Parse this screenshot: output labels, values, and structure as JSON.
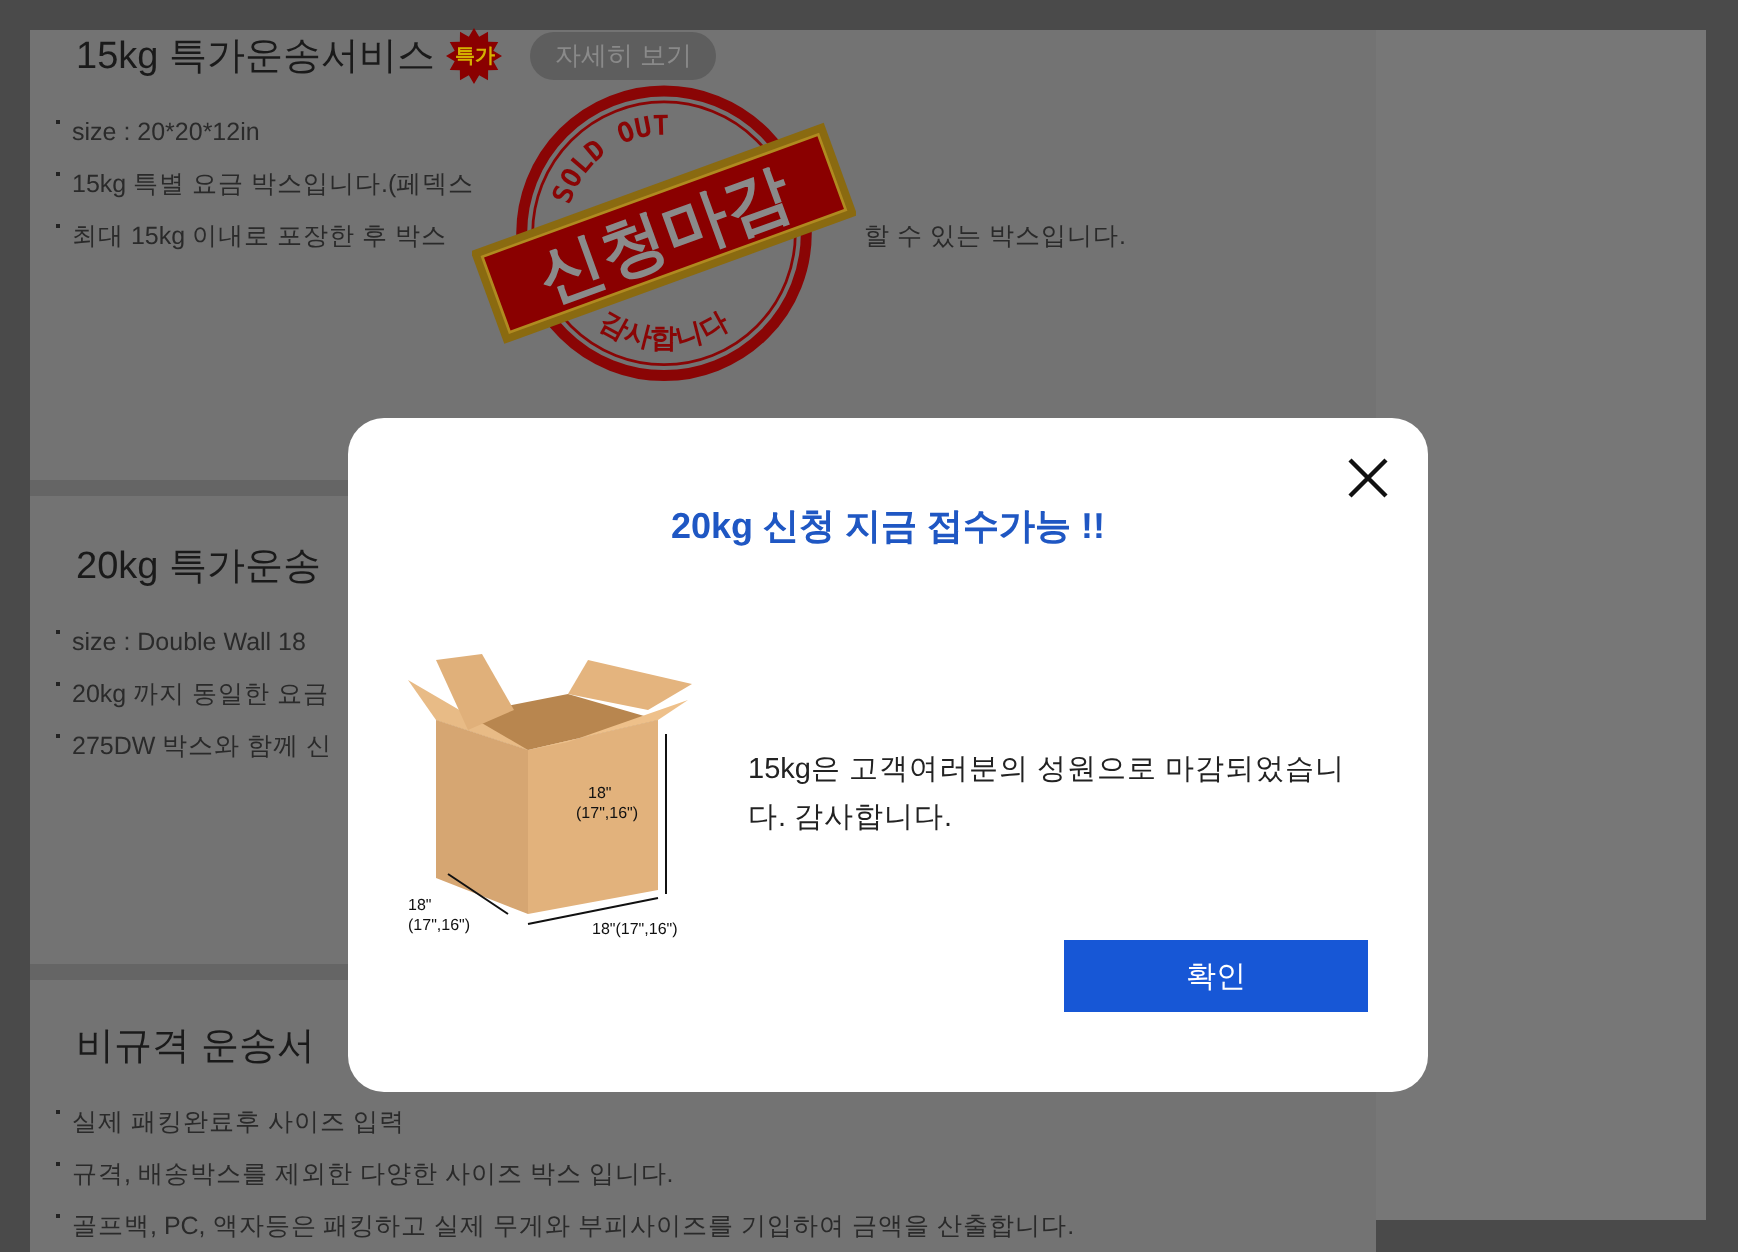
{
  "sections": [
    {
      "title": "15kg 특가운송서비스",
      "badge": "특가",
      "detail_button": "자세히 보기",
      "items": [
        {
          "text": "size : 20*20*12in"
        },
        {
          "text": "15kg 특별 요금 박스입니다.(페덱스"
        },
        {
          "text": "최대 15kg 이내로 포장한 후 박스",
          "tail": "할 수 있는 박스입니다."
        }
      ]
    },
    {
      "title": "20kg 특가운송",
      "items": [
        {
          "text": "size : Double Wall 18"
        },
        {
          "text": "20kg 까지 동일한 요금"
        },
        {
          "text": "275DW 박스와 함께 신"
        }
      ]
    },
    {
      "title": "비규격 운송서",
      "items": [
        {
          "text": "실제 패킹완료후 사이즈 입력"
        },
        {
          "text": "규격, 배송박스를 제외한 다양한 사이즈 박스 입니다."
        },
        {
          "text": "골프백, PC, 액자등은 패킹하고 실제 무게와 부피사이즈를 기입하여 금액을 산출합니다."
        }
      ]
    }
  ],
  "stamp": {
    "top_text": "SOLD OUT",
    "banner": "신청마감",
    "bottom_text": "감사합니다"
  },
  "modal": {
    "title": "20kg 신청 지금 접수가능 !!",
    "box_labels": {
      "height": [
        "18\"",
        "(17\",16\")"
      ],
      "depth": [
        "18\"",
        "(17\",16\")"
      ],
      "width": [
        "18\"(17\",16\")"
      ]
    },
    "message": "15kg은 고객여러분의 성원으로 마감되었습니다. 감사합니다.",
    "confirm_button": "확인"
  }
}
